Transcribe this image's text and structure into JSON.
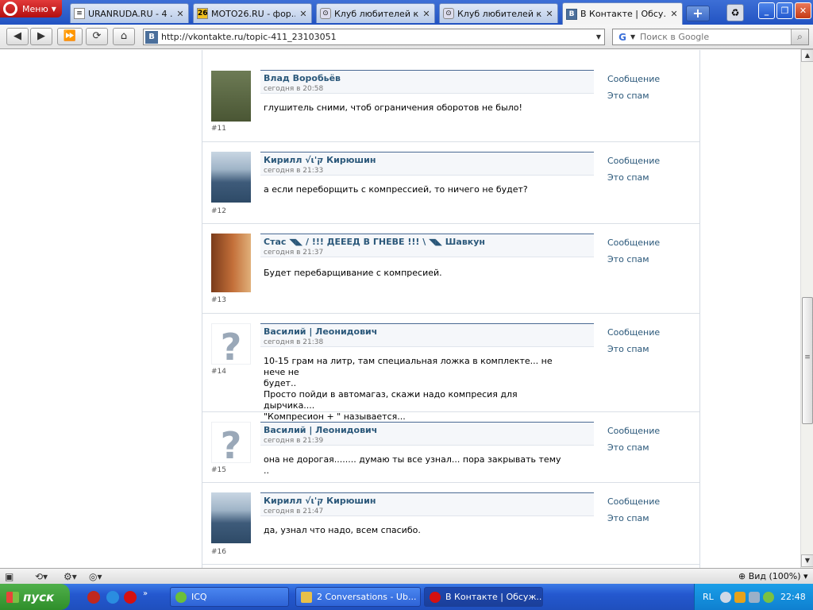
{
  "browser": {
    "menu_label": "Меню",
    "tabs": [
      {
        "title": "URANRUDA.RU - 4 ...",
        "favicon": "page-icon"
      },
      {
        "title": "MOTO26.RU - фор...",
        "favicon": "moto26-icon"
      },
      {
        "title": "Клуб любителей к...",
        "favicon": "club-icon"
      },
      {
        "title": "Клуб любителей к...",
        "favicon": "club-icon"
      },
      {
        "title": "В Контакте | Обсу...",
        "favicon": "vk-icon"
      }
    ],
    "url": "http://vkontakte.ru/topic-411_23103051",
    "search_placeholder": "Поиск в Google",
    "zoom": "Вид (100%)"
  },
  "posts": [
    {
      "number": "#11",
      "author": "Влад Воробьёв",
      "date": "сегодня в 20:58",
      "text": "глушитель сними, чтоб ограничения оборотов не было!"
    },
    {
      "number": "#12",
      "author": "Кирилл √ι'ק Кирюшин",
      "date": "сегодня в 21:33",
      "text": "а если переборщить с компрессией, то ничего не будет?"
    },
    {
      "number": "#13",
      "author": "Стас ◥◣ / !!! ДЕЕЕД В ГНЕВЕ !!! \\ ◥◣ Шавкун",
      "date": "сегодня в 21:37",
      "text": "Будет перебарщивание с компресией."
    },
    {
      "number": "#14",
      "author": "Василий | Леонидович",
      "date": "сегодня в 21:38",
      "text_lines": [
        "10-15 грам на литр, там специальная ложка в комплекте... не нече не",
        "будет..",
        "Просто пойди в автомагаз, скажи надо компресия для дырчика....",
        "\"Компресион + \" называется..."
      ]
    },
    {
      "number": "#15",
      "author": "Василий | Леонидович",
      "date": "сегодня в 21:39",
      "text": "она не дорогая........ думаю ты все узнал... пора закрывать тему .."
    },
    {
      "number": "#16",
      "author": "Кирилл √ι'ק Кирюшин",
      "date": "сегодня в 21:47",
      "text": "да, узнал что надо, всем спасибо."
    }
  ],
  "actions": {
    "message": "Сообщение",
    "spam": "Это спам"
  },
  "taskbar": {
    "start_label": "пуск",
    "tasks": [
      {
        "label": "ICQ"
      },
      {
        "label": "2 Conversations - Ub..."
      },
      {
        "label": "В Контакте | Обсуж..."
      }
    ],
    "lang": "RL",
    "clock": "22:48"
  },
  "colors": {
    "vk_link": "#2b587a",
    "header_rule": "#4a6a93",
    "taskbar": "#2458cf",
    "start": "#2f8f2b"
  }
}
